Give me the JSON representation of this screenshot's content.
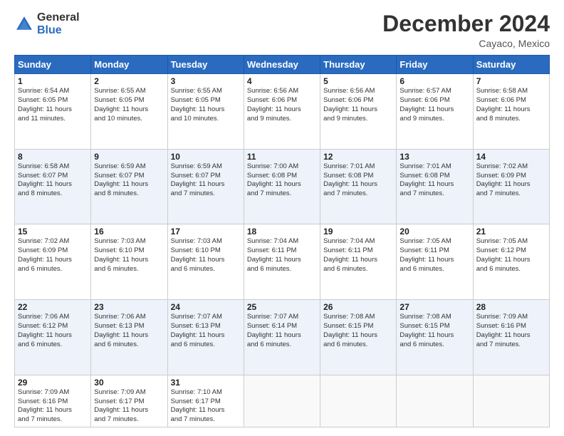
{
  "header": {
    "logo_general": "General",
    "logo_blue": "Blue",
    "month_year": "December 2024",
    "location": "Cayaco, Mexico"
  },
  "weekdays": [
    "Sunday",
    "Monday",
    "Tuesday",
    "Wednesday",
    "Thursday",
    "Friday",
    "Saturday"
  ],
  "weeks": [
    [
      {
        "day": "1",
        "sunrise": "6:54 AM",
        "sunset": "6:05 PM",
        "daylight": "11 hours and 11 minutes."
      },
      {
        "day": "2",
        "sunrise": "6:55 AM",
        "sunset": "6:05 PM",
        "daylight": "11 hours and 10 minutes."
      },
      {
        "day": "3",
        "sunrise": "6:55 AM",
        "sunset": "6:05 PM",
        "daylight": "11 hours and 10 minutes."
      },
      {
        "day": "4",
        "sunrise": "6:56 AM",
        "sunset": "6:06 PM",
        "daylight": "11 hours and 9 minutes."
      },
      {
        "day": "5",
        "sunrise": "6:56 AM",
        "sunset": "6:06 PM",
        "daylight": "11 hours and 9 minutes."
      },
      {
        "day": "6",
        "sunrise": "6:57 AM",
        "sunset": "6:06 PM",
        "daylight": "11 hours and 9 minutes."
      },
      {
        "day": "7",
        "sunrise": "6:58 AM",
        "sunset": "6:06 PM",
        "daylight": "11 hours and 8 minutes."
      }
    ],
    [
      {
        "day": "8",
        "sunrise": "6:58 AM",
        "sunset": "6:07 PM",
        "daylight": "11 hours and 8 minutes."
      },
      {
        "day": "9",
        "sunrise": "6:59 AM",
        "sunset": "6:07 PM",
        "daylight": "11 hours and 8 minutes."
      },
      {
        "day": "10",
        "sunrise": "6:59 AM",
        "sunset": "6:07 PM",
        "daylight": "11 hours and 7 minutes."
      },
      {
        "day": "11",
        "sunrise": "7:00 AM",
        "sunset": "6:08 PM",
        "daylight": "11 hours and 7 minutes."
      },
      {
        "day": "12",
        "sunrise": "7:01 AM",
        "sunset": "6:08 PM",
        "daylight": "11 hours and 7 minutes."
      },
      {
        "day": "13",
        "sunrise": "7:01 AM",
        "sunset": "6:08 PM",
        "daylight": "11 hours and 7 minutes."
      },
      {
        "day": "14",
        "sunrise": "7:02 AM",
        "sunset": "6:09 PM",
        "daylight": "11 hours and 7 minutes."
      }
    ],
    [
      {
        "day": "15",
        "sunrise": "7:02 AM",
        "sunset": "6:09 PM",
        "daylight": "11 hours and 6 minutes."
      },
      {
        "day": "16",
        "sunrise": "7:03 AM",
        "sunset": "6:10 PM",
        "daylight": "11 hours and 6 minutes."
      },
      {
        "day": "17",
        "sunrise": "7:03 AM",
        "sunset": "6:10 PM",
        "daylight": "11 hours and 6 minutes."
      },
      {
        "day": "18",
        "sunrise": "7:04 AM",
        "sunset": "6:11 PM",
        "daylight": "11 hours and 6 minutes."
      },
      {
        "day": "19",
        "sunrise": "7:04 AM",
        "sunset": "6:11 PM",
        "daylight": "11 hours and 6 minutes."
      },
      {
        "day": "20",
        "sunrise": "7:05 AM",
        "sunset": "6:11 PM",
        "daylight": "11 hours and 6 minutes."
      },
      {
        "day": "21",
        "sunrise": "7:05 AM",
        "sunset": "6:12 PM",
        "daylight": "11 hours and 6 minutes."
      }
    ],
    [
      {
        "day": "22",
        "sunrise": "7:06 AM",
        "sunset": "6:12 PM",
        "daylight": "11 hours and 6 minutes."
      },
      {
        "day": "23",
        "sunrise": "7:06 AM",
        "sunset": "6:13 PM",
        "daylight": "11 hours and 6 minutes."
      },
      {
        "day": "24",
        "sunrise": "7:07 AM",
        "sunset": "6:13 PM",
        "daylight": "11 hours and 6 minutes."
      },
      {
        "day": "25",
        "sunrise": "7:07 AM",
        "sunset": "6:14 PM",
        "daylight": "11 hours and 6 minutes."
      },
      {
        "day": "26",
        "sunrise": "7:08 AM",
        "sunset": "6:15 PM",
        "daylight": "11 hours and 6 minutes."
      },
      {
        "day": "27",
        "sunrise": "7:08 AM",
        "sunset": "6:15 PM",
        "daylight": "11 hours and 6 minutes."
      },
      {
        "day": "28",
        "sunrise": "7:09 AM",
        "sunset": "6:16 PM",
        "daylight": "11 hours and 7 minutes."
      }
    ],
    [
      {
        "day": "29",
        "sunrise": "7:09 AM",
        "sunset": "6:16 PM",
        "daylight": "11 hours and 7 minutes."
      },
      {
        "day": "30",
        "sunrise": "7:09 AM",
        "sunset": "6:17 PM",
        "daylight": "11 hours and 7 minutes."
      },
      {
        "day": "31",
        "sunrise": "7:10 AM",
        "sunset": "6:17 PM",
        "daylight": "11 hours and 7 minutes."
      },
      null,
      null,
      null,
      null
    ]
  ],
  "labels": {
    "sunrise": "Sunrise:",
    "sunset": "Sunset:",
    "daylight": "Daylight:"
  }
}
